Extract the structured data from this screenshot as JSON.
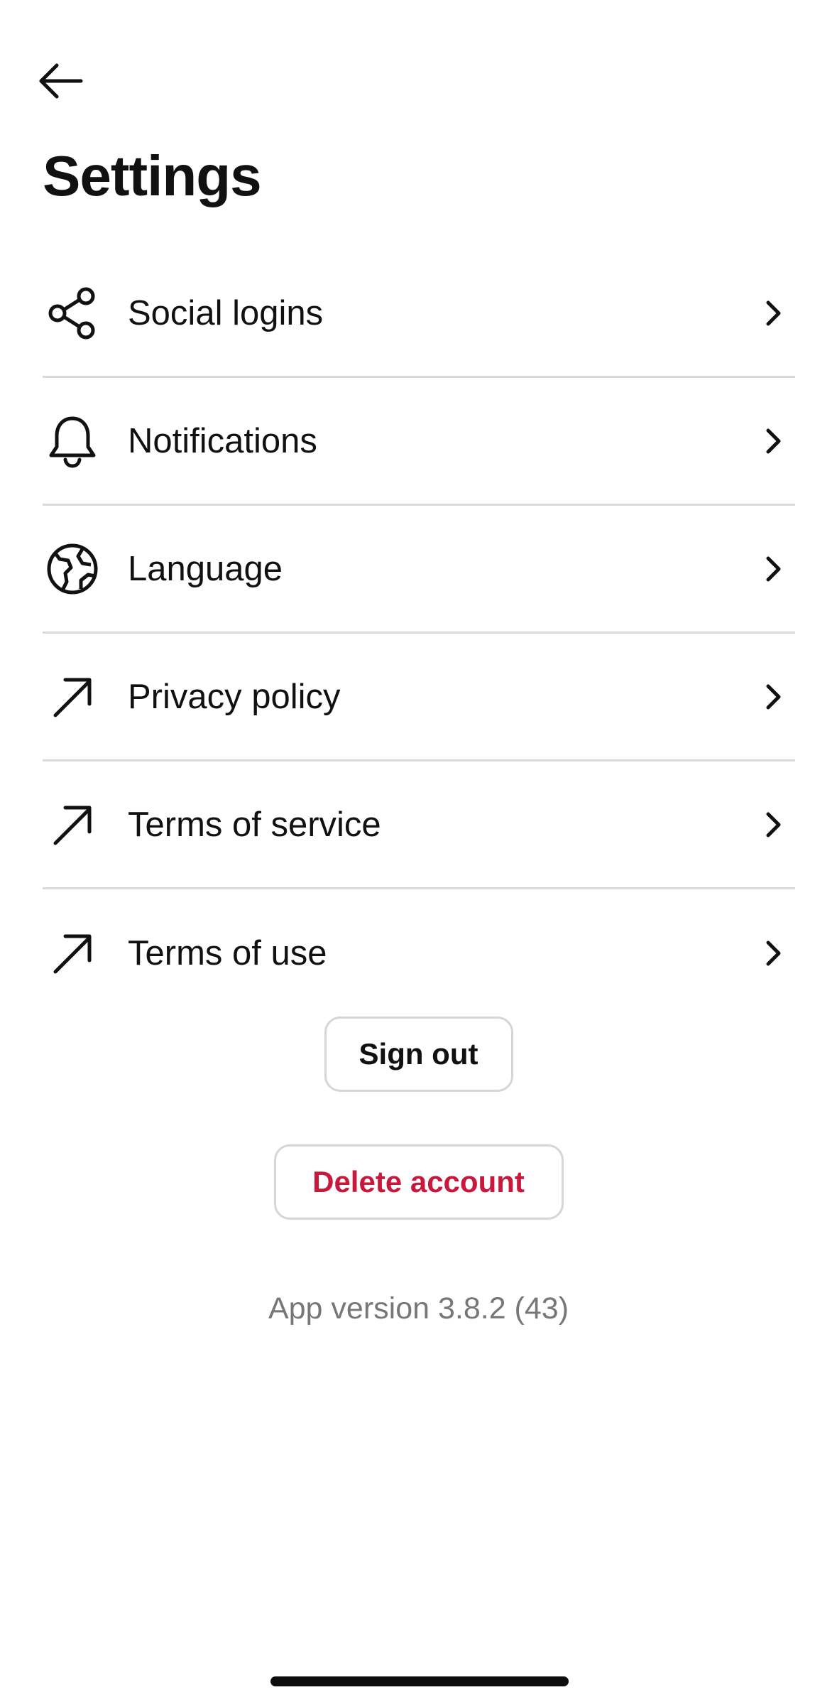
{
  "header": {
    "back_icon": "arrow-left-icon",
    "title": "Settings"
  },
  "menu": {
    "items": [
      {
        "label": "Social logins",
        "icon": "share-icon"
      },
      {
        "label": "Notifications",
        "icon": "bell-icon"
      },
      {
        "label": "Language",
        "icon": "globe-icon"
      },
      {
        "label": "Privacy policy",
        "icon": "external-link-arrow-icon"
      },
      {
        "label": "Terms of service",
        "icon": "external-link-arrow-icon"
      },
      {
        "label": "Terms of use",
        "icon": "external-link-arrow-icon"
      }
    ]
  },
  "actions": {
    "sign_out_label": "Sign out",
    "delete_account_label": "Delete account"
  },
  "footer": {
    "app_version": "App version 3.8.2 (43)"
  },
  "colors": {
    "text": "#111111",
    "divider": "#d9d9d9",
    "danger": "#c8193c",
    "muted": "#777777"
  }
}
